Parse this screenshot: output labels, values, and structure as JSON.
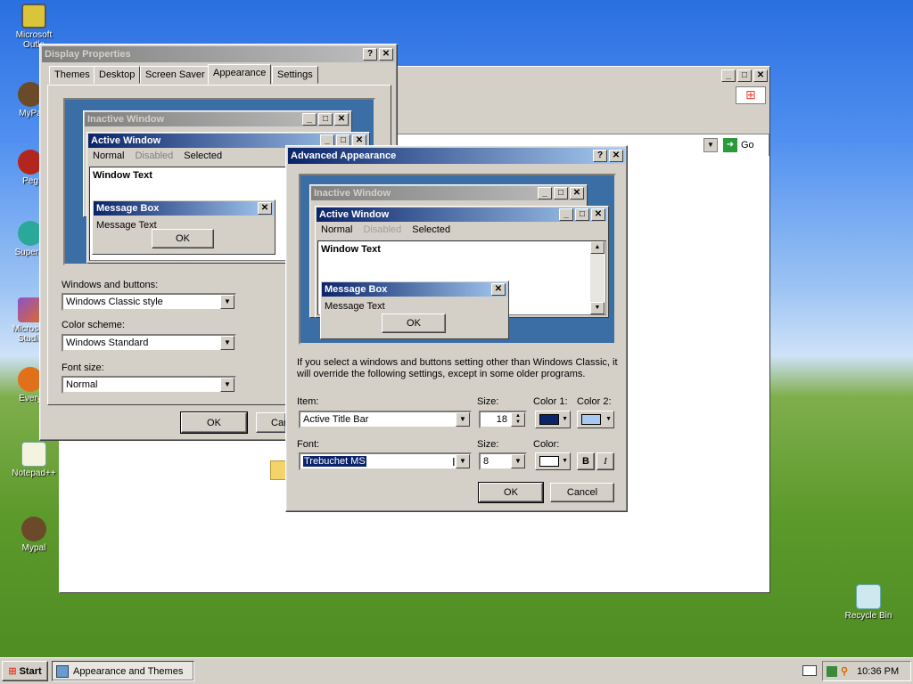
{
  "desktop": {
    "icons": [
      {
        "label": "Microsoft Outlo",
        "icon": "outlook-icon"
      },
      {
        "label": "MyPa",
        "icon": "mypal-icon"
      },
      {
        "label": "Peg",
        "icon": "pegasus-icon"
      },
      {
        "label": "Superm",
        "icon": "supermium-icon"
      },
      {
        "label": "Microsoft Studio",
        "icon": "studio-icon"
      },
      {
        "label": "Every",
        "icon": "everything-icon"
      },
      {
        "label": "Notepad++",
        "icon": "notepadpp-icon"
      },
      {
        "label": "Mypal",
        "icon": "mypal-icon"
      },
      {
        "label": "Recycle Bin",
        "icon": "recycle-bin-icon"
      }
    ]
  },
  "bgwindow": {
    "go_label": "Go"
  },
  "display": {
    "title": "Display Properties",
    "tabs": [
      "Themes",
      "Desktop",
      "Screen Saver",
      "Appearance",
      "Settings"
    ],
    "preview": {
      "inactive": "Inactive Window",
      "active": "Active Window",
      "menu": [
        "Normal",
        "Disabled",
        "Selected"
      ],
      "window_text": "Window Text",
      "msgbox_title": "Message Box",
      "msgbox_text": "Message Text",
      "ok": "OK"
    },
    "windows_buttons_label": "Windows and buttons:",
    "windows_buttons_value": "Windows Classic style",
    "color_scheme_label": "Color scheme:",
    "color_scheme_value": "Windows Standard",
    "font_size_label": "Font size:",
    "font_size_value": "Normal",
    "ok": "OK",
    "cancel": "Car"
  },
  "advanced": {
    "title": "Advanced Appearance",
    "preview": {
      "inactive": "Inactive Window",
      "active": "Active Window",
      "menu": [
        "Normal",
        "Disabled",
        "Selected"
      ],
      "window_text": "Window Text",
      "msgbox_title": "Message Box",
      "msgbox_text": "Message Text",
      "ok": "OK"
    },
    "info": "If you select a windows and buttons setting other than Windows Classic, it will override the following settings, except in some older programs.",
    "item_label": "Item:",
    "item_value": "Active Title Bar",
    "size_label": "Size:",
    "size_value": "18",
    "color1_label": "Color 1:",
    "color2_label": "Color 2:",
    "color1": "#0a246a",
    "color2": "#a6caf0",
    "font_label": "Font:",
    "font_value": "Trebuchet MS",
    "font_size_label": "Size:",
    "font_size_value": "8",
    "color_label": "Color:",
    "font_color": "#ffffff",
    "bold": "B",
    "italic": "I",
    "ok": "OK",
    "cancel": "Cancel"
  },
  "taskbar": {
    "start": "Start",
    "task": "Appearance and Themes",
    "time": "10:36 PM"
  }
}
